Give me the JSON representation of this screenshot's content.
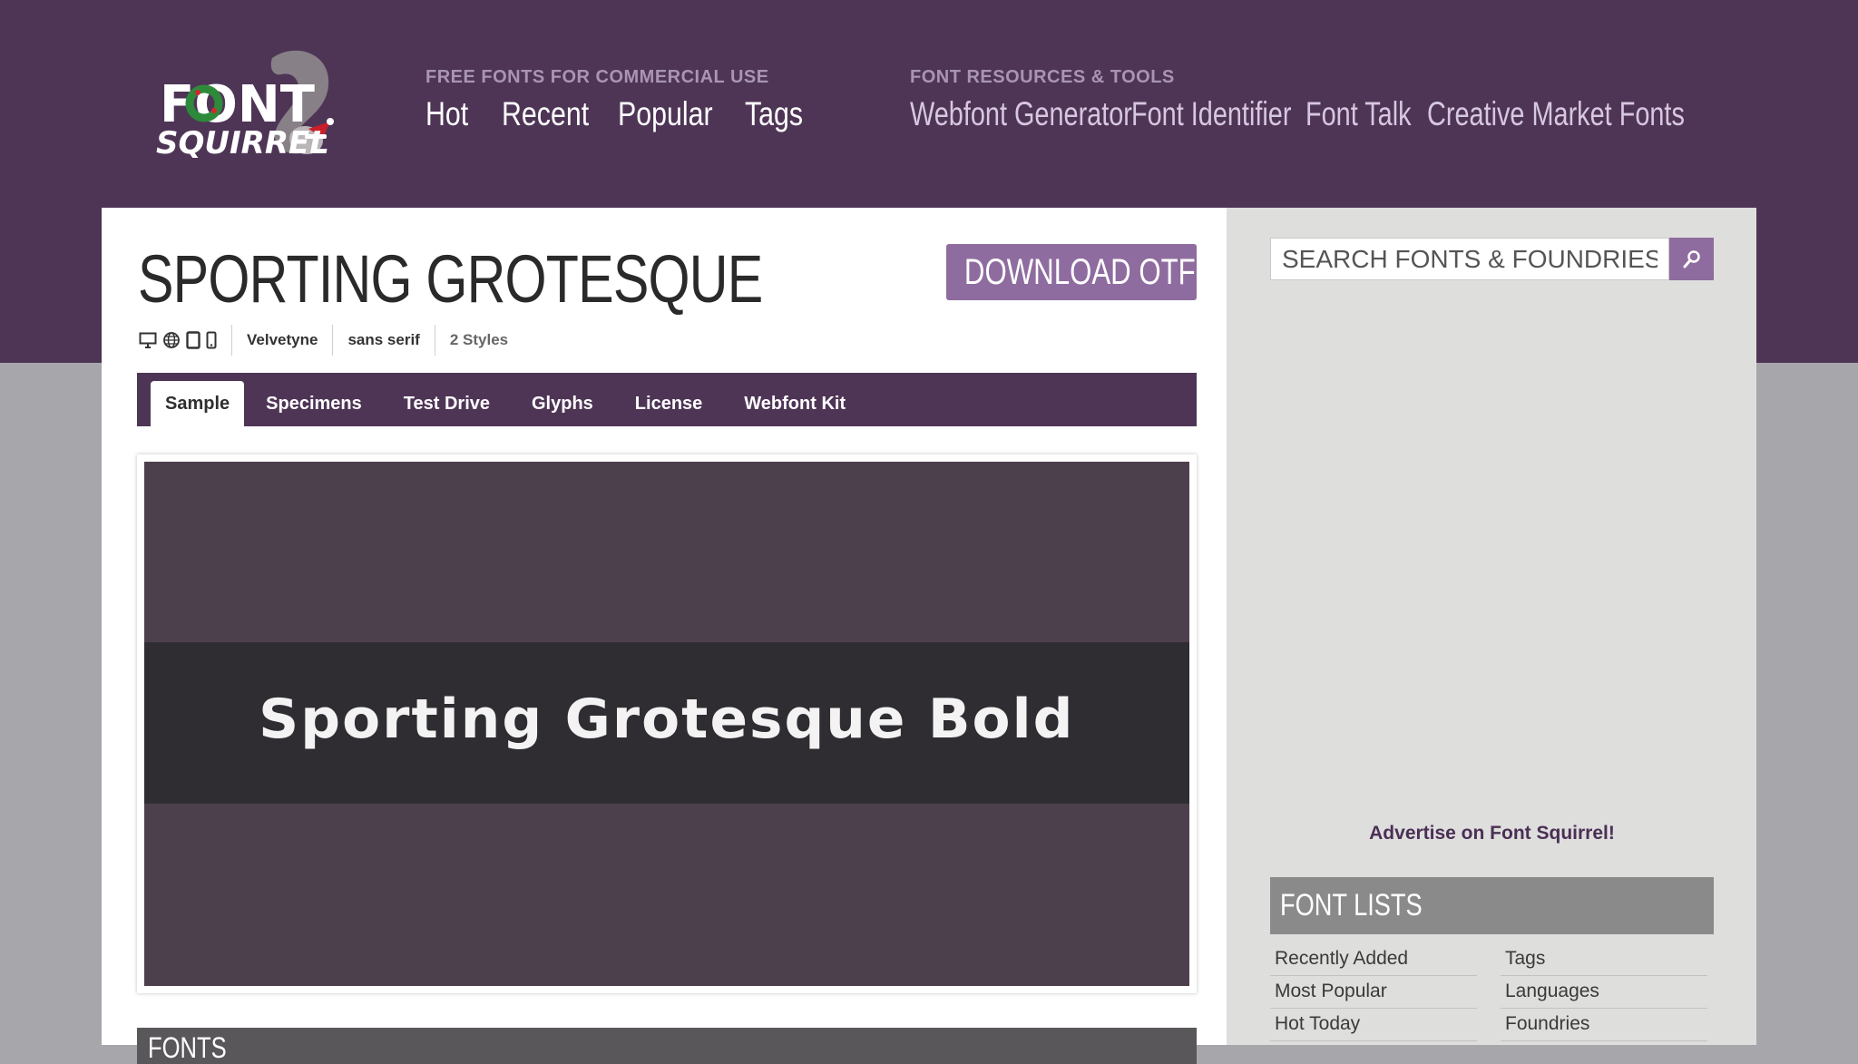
{
  "header": {
    "logo_text_top": "FONT",
    "logo_text_bottom": "SQUIRREL",
    "free_heading": "FREE FONTS FOR COMMERCIAL USE",
    "free_links": [
      "Hot",
      "Recent",
      "Popular",
      "Tags"
    ],
    "tools_heading": "FONT RESOURCES & TOOLS",
    "tools_links": [
      "Webfont Generator",
      "Font Identifier",
      "Font Talk",
      "Creative Market Fonts"
    ]
  },
  "font": {
    "title": "SPORTING GROTESQUE",
    "download_label": "DOWNLOAD OTF",
    "foundry": "Velvetyne",
    "classification": "sans serif",
    "styles": "2 Styles",
    "platform_icons": [
      "desktop-icon",
      "web-icon",
      "tablet-icon",
      "phone-icon"
    ]
  },
  "tabs": [
    "Sample",
    "Specimens",
    "Test Drive",
    "Glyphs",
    "License",
    "Webfont Kit"
  ],
  "active_tab": "Sample",
  "sample": {
    "text": "Sporting Grotesque Bold"
  },
  "fonts_section": {
    "title": "FONTS"
  },
  "sidebar": {
    "search_placeholder": "SEARCH FONTS & FOUNDRIES",
    "advertise": "Advertise on Font Squirrel!",
    "lists_title": "FONT LISTS",
    "lists_left": [
      "Recently Added",
      "Most Popular",
      "Hot Today"
    ],
    "lists_right": [
      "Tags",
      "Languages",
      "Foundries"
    ]
  },
  "colors": {
    "brand_purple": "#4e3556",
    "accent_purple": "#8f6c9f",
    "page_gray": "#a7a6aa",
    "sidebar_gray": "#dededd"
  }
}
